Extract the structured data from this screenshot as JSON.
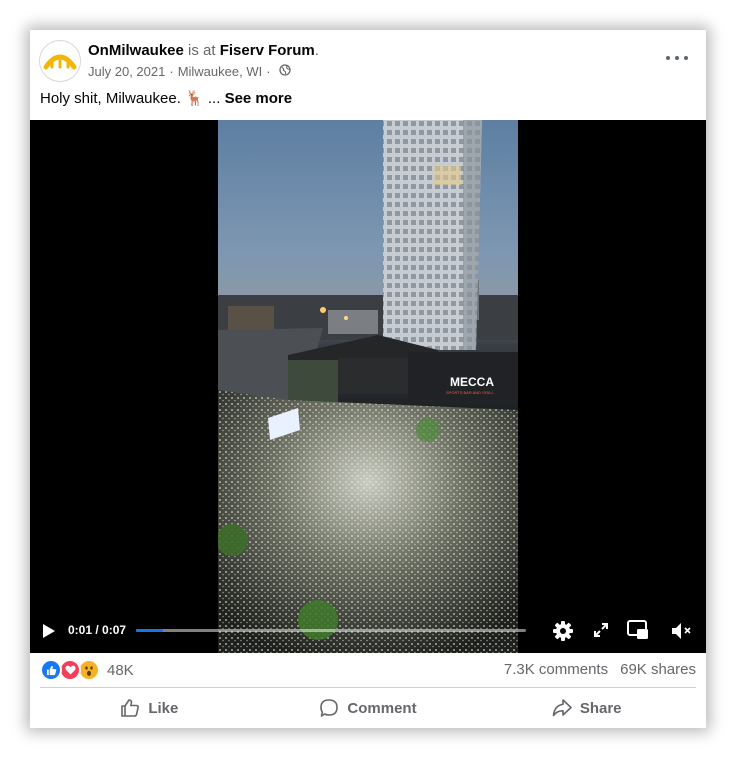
{
  "post": {
    "page_name": "OnMilwaukee",
    "is_at_text": " is at ",
    "location_name": "Fiserv Forum",
    "period": ".",
    "date": "July 20, 2021",
    "separator": "·",
    "place": "Milwaukee, WI",
    "audience_icon": "globe-icon",
    "caption_text": "Holy shit, Milwaukee. 🦌 ... ",
    "see_more": "See more"
  },
  "video": {
    "time_display": "0:01 / 0:07",
    "progress": 0.07,
    "accent_color": "#1b74e4",
    "controls": [
      "play-icon",
      "settings-icon",
      "fullscreen-icon",
      "picture-in-picture-icon",
      "muted-volume-icon"
    ]
  },
  "scene": {
    "sign_text": "MECCA",
    "sign_subtext": "SPORTS BAR AND GRILL"
  },
  "engagement": {
    "reactions": [
      "like",
      "love",
      "wow"
    ],
    "reaction_count": "48K",
    "comments": "7.3K comments",
    "shares": "69K shares"
  },
  "actions": {
    "like": "Like",
    "comment": "Comment",
    "share": "Share"
  },
  "colors": {
    "like_blue": "#1877f2",
    "love_red": "#f33e58",
    "wow_yellow": "#f7b125",
    "muted_text": "#65676b"
  }
}
